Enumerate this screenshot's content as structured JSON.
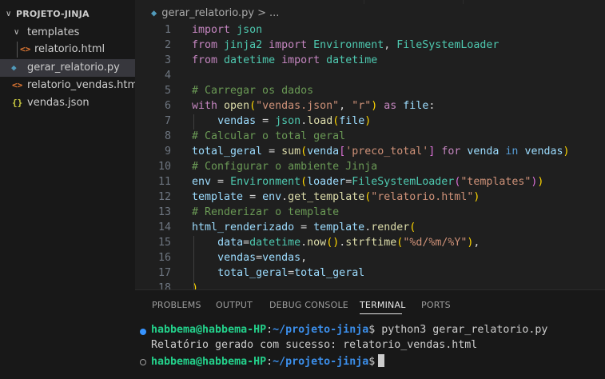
{
  "explorer": {
    "root": "PROJETO-JINJA",
    "items": [
      {
        "label": "templates",
        "type": "folder"
      },
      {
        "label": "relatorio.html",
        "type": "html",
        "icon": "<>"
      },
      {
        "label": "gerar_relatorio.py",
        "type": "python",
        "icon": "py"
      },
      {
        "label": "relatorio_vendas.html",
        "type": "html",
        "icon": "<>"
      },
      {
        "label": "vendas.json",
        "type": "json",
        "icon": "{}"
      }
    ]
  },
  "editor": {
    "breadcrumb": {
      "file": "gerar_relatorio.py",
      "separator": ">",
      "more": "..."
    },
    "line_numbers": [
      "1",
      "2",
      "3",
      "4",
      "5",
      "6",
      "7",
      "8",
      "9",
      "10",
      "11",
      "12",
      "13",
      "14",
      "15",
      "16",
      "17",
      "18"
    ],
    "lines": [
      "import json",
      "from jinja2 import Environment, FileSystemLoader",
      "from datetime import datetime",
      "",
      "# Carregar os dados",
      "with open(\"vendas.json\", \"r\") as file:",
      "    vendas = json.load(file)",
      "# Calcular o total geral",
      "total_geral = sum(venda['preco_total'] for venda in vendas)",
      "# Configurar o ambiente Jinja",
      "env = Environment(loader=FileSystemLoader(\"templates\"))",
      "template = env.get_template(\"relatorio.html\")",
      "# Renderizar o template",
      "html_renderizado = template.render(",
      "    data=datetime.now().strftime(\"%d/%m/%Y\"),",
      "    vendas=vendas,",
      "    total_geral=total_geral",
      ")"
    ]
  },
  "panel": {
    "tabs": [
      "PROBLEMS",
      "OUTPUT",
      "DEBUG CONSOLE",
      "TERMINAL",
      "PORTS"
    ],
    "active_tab": "TERMINAL",
    "terminal": {
      "user_host": "habbema@habbema-HP",
      "sep": ":",
      "path": "~/projeto-jinja",
      "prompt": "$",
      "command": " python3 gerar_relatorio.py",
      "output": "Relatório gerado com sucesso: relatorio_vendas.html"
    }
  },
  "colors": {
    "accent": "#3794ff",
    "terminal_user": "#23d18b",
    "terminal_path": "#3b8eea"
  }
}
